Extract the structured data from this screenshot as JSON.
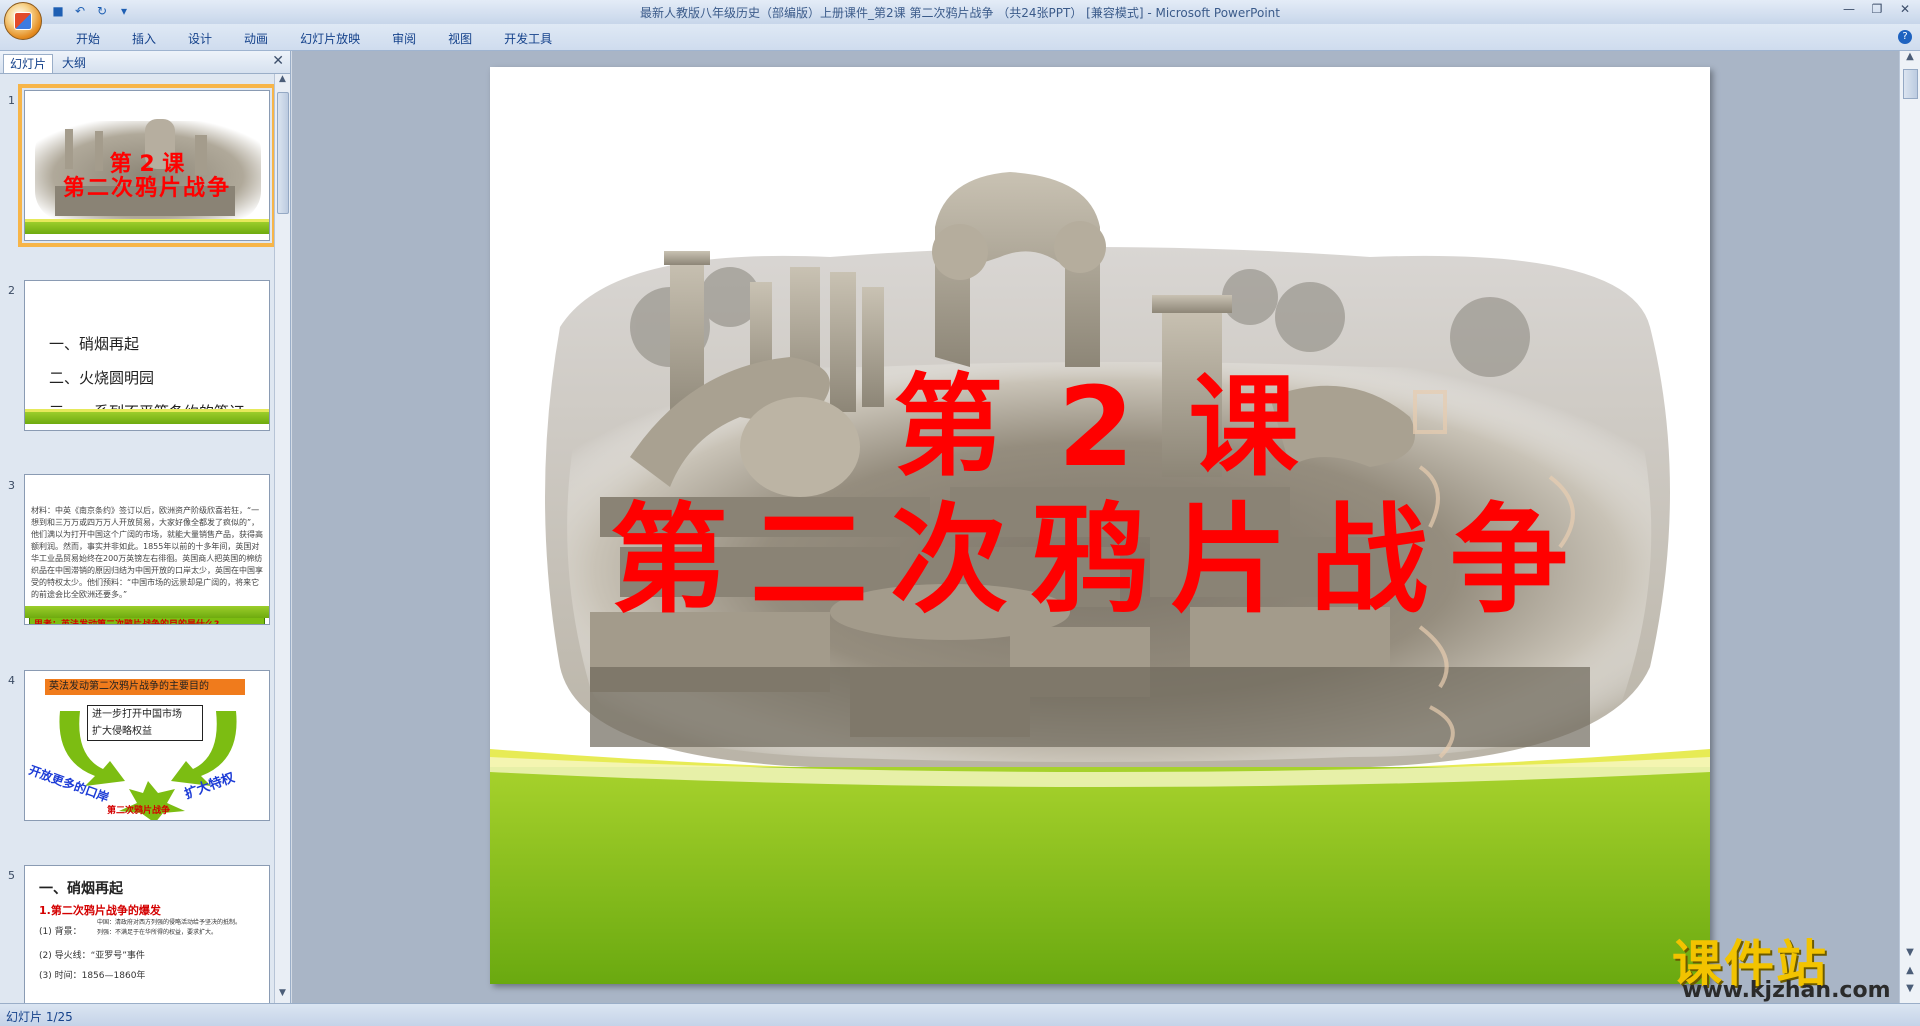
{
  "window": {
    "title": "最新人教版八年级历史（部编版）上册课件_第2课  第二次鸦片战争 （共24张PPT） [兼容模式] - Microsoft PowerPoint"
  },
  "ribbon": {
    "tabs": [
      "开始",
      "插入",
      "设计",
      "动画",
      "幻灯片放映",
      "审阅",
      "视图",
      "开发工具"
    ]
  },
  "pane": {
    "tab_slides": "幻灯片",
    "tab_outline": "大纲",
    "close": "✕"
  },
  "thumbnails": [
    {
      "num": "1",
      "title_line1": "第 2 课",
      "title_line2": "第二次鸦片战争"
    },
    {
      "num": "2",
      "items": [
        "一、硝烟再起",
        "二、火烧圆明园",
        "三、一系列不平等条约的签订"
      ]
    },
    {
      "num": "3",
      "text": "材料：中英《南京条约》签订以后，欧洲资产阶级欣喜若狂，“一想到和三万万或四万万人开放贸易，大家好像全都发了疯似的”，他们满以为打开中国这个广阔的市场，就能大量销售产品，获得高额利润。然而，事实并非如此。1855年以前的十多年间，英国对华工业品贸易始终在200万英镑左右徘徊。英国商人把英国的棉纺织品在中国滞销的原因归结为中国开放的口岸太少，英国在中国享受的特权太少。他们预料：“中国市场的远景却是广阔的，将来它的前途会比全欧洲还要多。”",
      "question": "思考：英法发动第二次鸦片战争的目的是什么?"
    },
    {
      "num": "4",
      "header": "英法发动第二次鸦片战争的主要目的",
      "box1": "进一步打开中国市场",
      "box2": "扩大侵略权益",
      "left_arc": "开放更多的口岸",
      "right_arc": "扩大特权",
      "star": "第二次鸦片战争"
    },
    {
      "num": "5",
      "heading": "一、硝烟再起",
      "sub": "1.第二次鸦片战争的爆发",
      "l1": "(1) 背景：",
      "l1_detail_a": "中国：清政府对西方列强的侵略活动给予坚决的抵制。",
      "l1_detail_b": "列强：不满足于在华所得的权益，要求扩大。",
      "l2": "(2) 导火线：“亚罗号”事件",
      "l3": "(3) 时间：1856—1860年"
    }
  ],
  "slide": {
    "line1": "第 2 课",
    "line2": "第二次鸦片战争"
  },
  "status": {
    "text": "幻灯片 1/25"
  },
  "watermark": {
    "cn": "课件站",
    "url": "www.kjzhan.com"
  },
  "colors": {
    "title_red": "#ff0000",
    "band_green": "#7cbd12",
    "band_yellow": "#e7eb55",
    "selection_orange": "#f7b548"
  }
}
